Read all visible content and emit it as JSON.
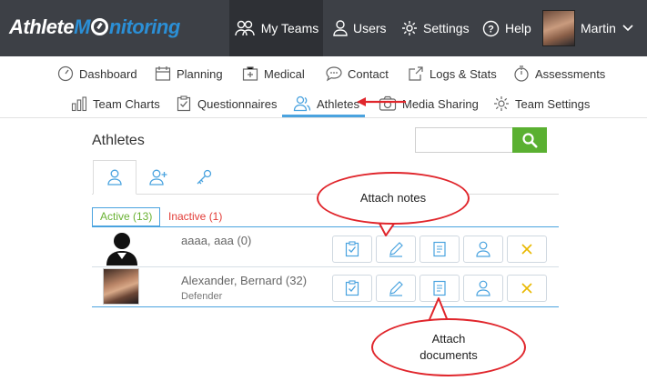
{
  "app": {
    "logo_part1": "Athlete",
    "logo_part2": "M",
    "logo_part3": "nitoring"
  },
  "topnav": {
    "my_teams": "My Teams",
    "users": "Users",
    "settings": "Settings",
    "help": "Help",
    "user_name": "Martin"
  },
  "subnav": {
    "row1": [
      "Dashboard",
      "Planning",
      "Medical",
      "Contact",
      "Logs & Stats",
      "Assessments"
    ],
    "row2": [
      "Team Charts",
      "Questionnaires",
      "Athletes",
      "Media Sharing",
      "Team Settings"
    ]
  },
  "page": {
    "title": "Athletes",
    "search_placeholder": ""
  },
  "filters": {
    "active": "Active (13)",
    "inactive": "Inactive (1)"
  },
  "athletes": [
    {
      "name": "aaaa, aaa (0)",
      "position": ""
    },
    {
      "name": "Alexander, Bernard (32)",
      "position": "Defender"
    }
  ],
  "callouts": {
    "notes": "Attach notes",
    "documents_line1": "Attach",
    "documents_line2": "documents"
  },
  "colors": {
    "topbar": "#3d4046",
    "accent_blue": "#4aa3df",
    "active_green": "#6ab233",
    "inactive_red": "#e23b36",
    "search_green": "#5ab031",
    "delete_yellow": "#e8b800",
    "callout_red": "#e0262c"
  }
}
